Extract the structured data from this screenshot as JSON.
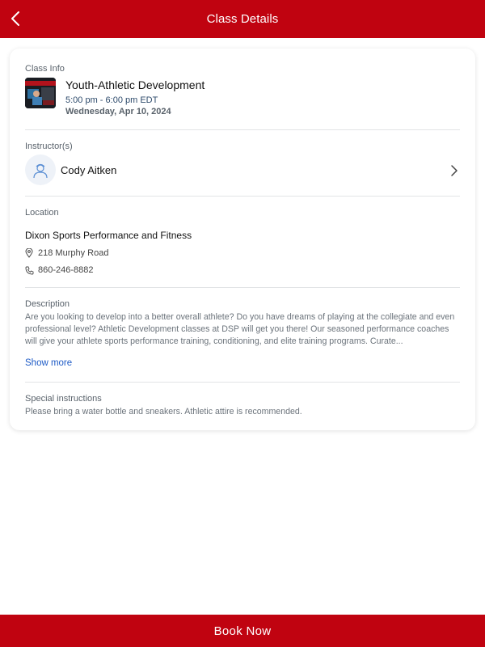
{
  "header": {
    "title": "Class Details"
  },
  "class_info": {
    "label": "Class Info",
    "title": "Youth-Athletic Development",
    "time": "5:00 pm - 6:00 pm EDT",
    "date": "Wednesday, Apr 10, 2024"
  },
  "instructor": {
    "label": "Instructor(s)",
    "name": "Cody Aitken"
  },
  "location": {
    "label": "Location",
    "name": "Dixon Sports Performance and Fitness",
    "address": "218 Murphy Road",
    "phone": "860-246-8882"
  },
  "description": {
    "label": "Description",
    "text": "Are you looking to develop into a better overall athlete? Do you have dreams of playing at the collegiate and even professional level? Athletic Development classes at DSP will get you there! Our seasoned performance coaches will give your athlete sports performance training, conditioning, and elite training programs. Curate...",
    "show_more": "Show more"
  },
  "special": {
    "label": "Special instructions",
    "text": "Please bring a water bottle and sneakers. Athletic attire is recommended."
  },
  "footer": {
    "book_label": "Book Now"
  },
  "colors": {
    "brand": "#c00310",
    "link": "#1e5bc6"
  },
  "icons": {
    "back": "chevron-left-icon",
    "instructor_arrow": "chevron-right-icon",
    "location": "map-pin-icon",
    "phone": "phone-icon",
    "avatar": "person-icon"
  }
}
